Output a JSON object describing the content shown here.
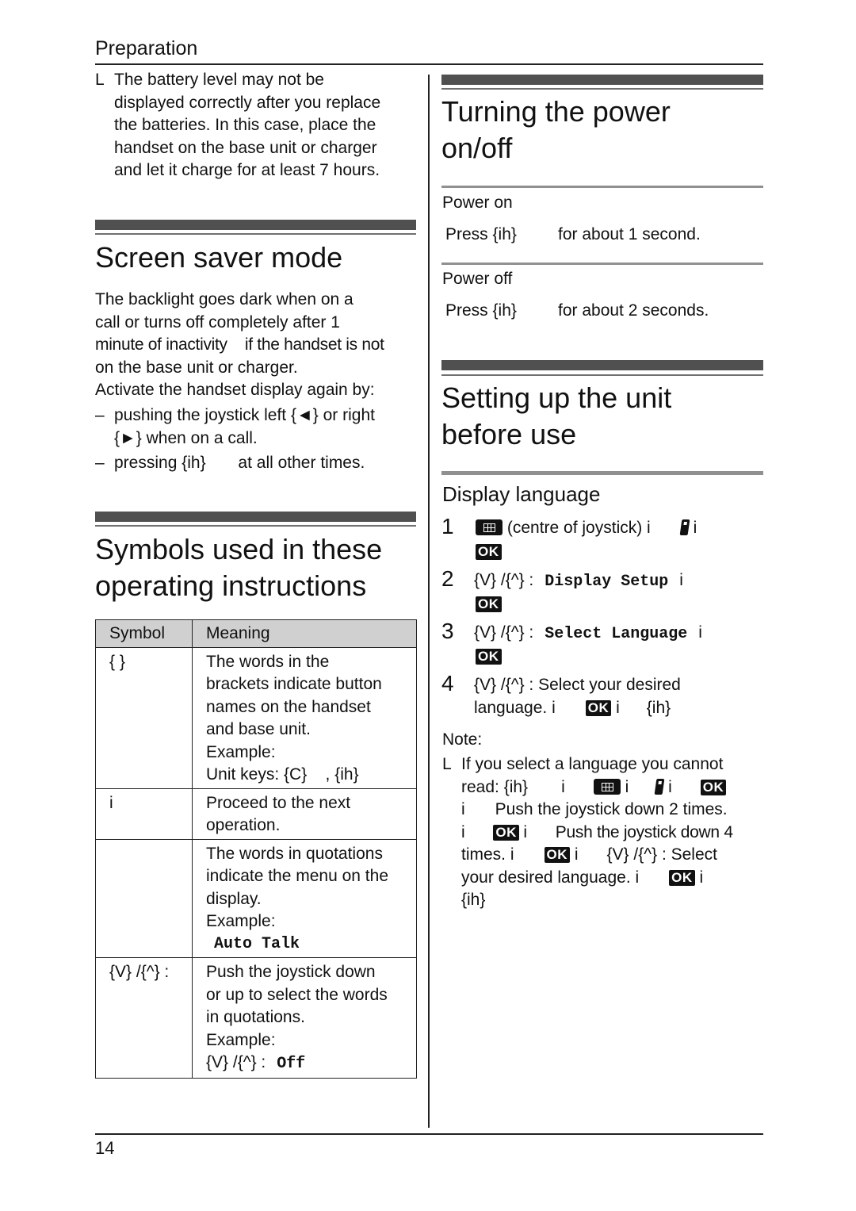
{
  "header": {
    "section": "Preparation"
  },
  "battery_note": {
    "bullet": "L",
    "lines": [
      "The battery level may not be",
      "displayed correctly after you replace",
      "the batteries. In this case, place the",
      "handset on the base unit or charger",
      "and let it charge for at least 7 hours."
    ]
  },
  "screen_saver": {
    "title": "Screen saver mode",
    "lines": [
      "The backlight goes dark when on a",
      "call or turns off completely after 1",
      "minute of inactivity    if the handset is not",
      "on the base unit or charger.",
      "Activate the handset display again by:"
    ],
    "items": [
      {
        "dash": "–",
        "lines": [
          "pushing the joystick left {◄} or right",
          "{►} when on a call."
        ]
      },
      {
        "dash": "–",
        "lines": [
          "pressing {ih}       at all other times."
        ]
      }
    ]
  },
  "symbols": {
    "title_lines": [
      "Symbols used in these",
      "operating instructions"
    ],
    "table": {
      "headers": [
        "Symbol",
        "Meaning"
      ],
      "rows": [
        {
          "symbol": "{ }",
          "meaning": [
            "The words in the",
            "brackets indicate button",
            "names on the handset",
            "and base unit.",
            "Example:",
            "Unit keys: {C}    , {ih}"
          ]
        },
        {
          "symbol": "i",
          "meaning": [
            "Proceed to the next",
            "operation."
          ]
        },
        {
          "symbol": "",
          "meaning": [
            "The words in quotations",
            "indicate the menu on the",
            "display.",
            "Example:"
          ],
          "example_mono": "Auto Talk"
        },
        {
          "symbol": "{V} /{^} :",
          "meaning": [
            "Push the joystick down",
            "or up to select the words",
            "in quotations.",
            "Example:"
          ],
          "example_prefix": "{V} /{^} :",
          "example_mono": "Off"
        }
      ]
    }
  },
  "power": {
    "title_lines": [
      "Turning the power",
      "on/off"
    ],
    "on": {
      "label": "Power on",
      "press": "Press {ih}",
      "duration": "for about 1 second."
    },
    "off": {
      "label": "Power off",
      "press": "Press {ih}",
      "duration": "for about 2 seconds."
    }
  },
  "setup": {
    "title_lines": [
      "Setting up the unit",
      "before use"
    ],
    "subtitle": "Display language",
    "ok_label": "OK",
    "steps": [
      {
        "num": "1",
        "text": "(centre of joystick) i",
        "after_icon": "i"
      },
      {
        "num": "2",
        "prefix": "{V} /{^} :",
        "menu": "Display Setup",
        "suffix": "i"
      },
      {
        "num": "3",
        "prefix": "{V} /{^} :",
        "menu": "Select Language",
        "suffix": "i"
      },
      {
        "num": "4",
        "line1": "{V} /{^} : Select your desired",
        "line2a": "language. i",
        "line2b": "i",
        "line2c": "{ih}"
      }
    ],
    "note": {
      "label": "Note:",
      "bullet": "L",
      "line1": "If you select a language you cannot",
      "line2a": "read: {ih}",
      "i": "i",
      "line3": "Push the joystick down 2 times.",
      "line4": "Push the joystick down 4",
      "line5a": "times. i",
      "line5b": "{V} /{^} : Select",
      "line6a": "your desired language. i",
      "line7": "{ih}"
    }
  },
  "footer": {
    "page_number": "14"
  }
}
